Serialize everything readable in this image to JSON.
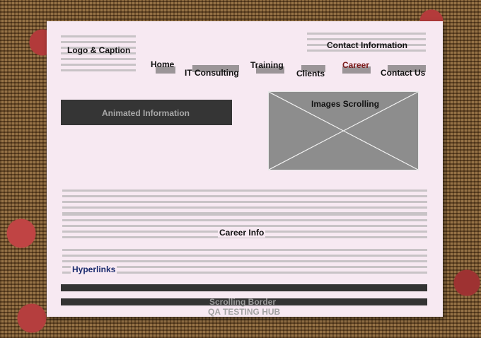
{
  "header": {
    "logo_caption": "Logo & Caption",
    "contact_information": "Contact Information"
  },
  "nav": {
    "home": "Home",
    "it_consulting": "IT Consulting",
    "training": "Training",
    "clients": "Clients",
    "career": "Career",
    "contact_us": "Contact Us"
  },
  "main": {
    "animated_information": "Animated Information",
    "images_scrolling": "Images Scrolling",
    "career_info": "Career Info",
    "hyperlinks": "Hyperlinks"
  },
  "footer": {
    "scrolling_border": "Scrolling Border",
    "brand": "QA TESTING HUB"
  },
  "colors": {
    "active_nav": "#7a1a1a",
    "hyperlink": "#1a2b6e",
    "panel": "#f7e9f2",
    "dark_bar": "#333333"
  }
}
